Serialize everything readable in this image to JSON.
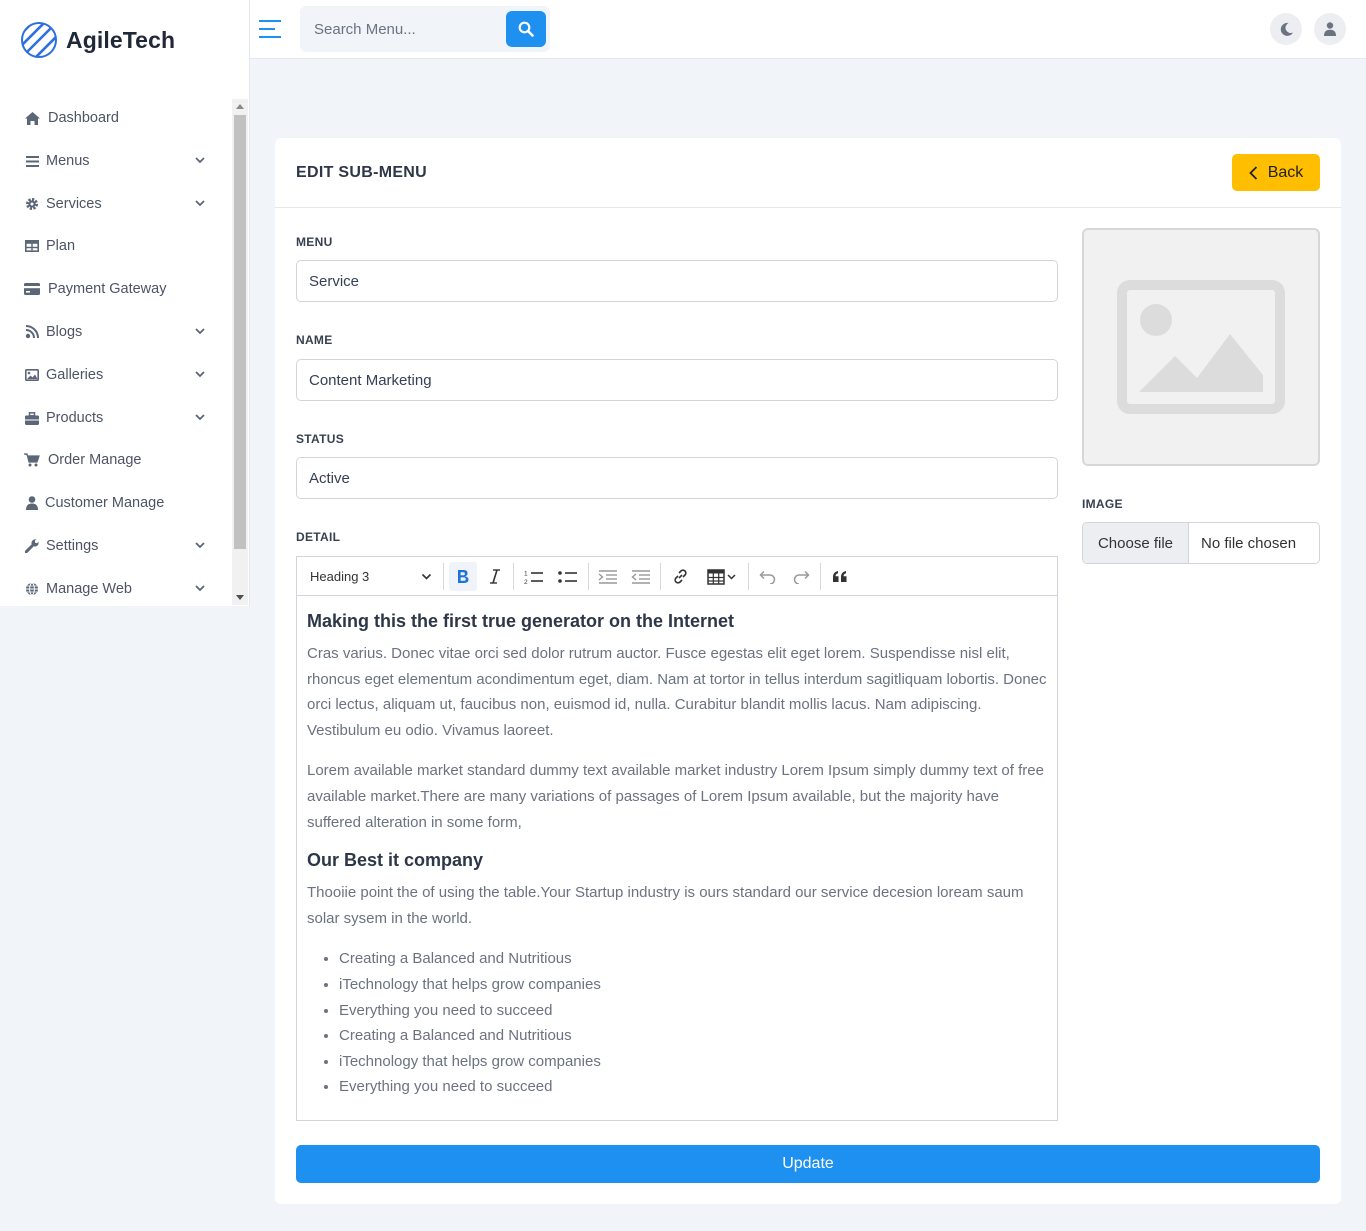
{
  "brand": {
    "name": "AgileTech"
  },
  "topbar": {
    "search_placeholder": "Search Menu...",
    "icons": [
      "hamburger-icon",
      "search-icon",
      "moon-icon",
      "user-icon"
    ]
  },
  "sidebar": {
    "items": [
      {
        "label": "Dashboard",
        "icon": "home-icon",
        "has_children": false
      },
      {
        "label": "Menus",
        "icon": "bars-icon",
        "has_children": true
      },
      {
        "label": "Services",
        "icon": "gear-icon",
        "has_children": true
      },
      {
        "label": "Plan",
        "icon": "table-icon",
        "has_children": false
      },
      {
        "label": "Payment Gateway",
        "icon": "credit-card-icon",
        "has_children": false
      },
      {
        "label": "Blogs",
        "icon": "blog-icon",
        "has_children": true
      },
      {
        "label": "Galleries",
        "icon": "image-icon",
        "has_children": true
      },
      {
        "label": "Products",
        "icon": "briefcase-icon",
        "has_children": true
      },
      {
        "label": "Order Manage",
        "icon": "cart-icon",
        "has_children": false
      },
      {
        "label": "Customer Manage",
        "icon": "user-icon",
        "has_children": false
      },
      {
        "label": "Settings",
        "icon": "wrench-icon",
        "has_children": true
      },
      {
        "label": "Manage Web",
        "icon": "globe-icon",
        "has_children": true
      }
    ]
  },
  "card": {
    "title": "EDIT SUB-MENU",
    "back_label": "Back"
  },
  "form": {
    "menu": {
      "label": "MENU",
      "value": "Service"
    },
    "name": {
      "label": "NAME",
      "value": "Content Marketing"
    },
    "status": {
      "label": "STATUS",
      "value": "Active"
    },
    "detail": {
      "label": "DETAIL"
    },
    "image": {
      "label": "IMAGE",
      "choose_label": "Choose file",
      "status": "No file chosen"
    },
    "update_label": "Update"
  },
  "editor": {
    "heading_select": "Heading 3",
    "toolbar_icons": [
      "bold-icon",
      "italic-icon",
      "numbered-list-icon",
      "bulleted-list-icon",
      "indent-icon",
      "outdent-icon",
      "link-icon",
      "table-icon",
      "undo-icon",
      "redo-icon",
      "blockquote-icon"
    ],
    "content": {
      "h1": "Making this the first true generator on the Internet",
      "p1": "Cras varius. Donec vitae orci sed dolor rutrum auctor. Fusce egestas elit eget lorem. Suspendisse nisl elit, rhoncus eget elementum acondimentum eget, diam. Nam at tortor in tellus interdum sagitliquam lobortis. Donec orci lectus, aliquam ut, faucibus non, euismod id, nulla. Curabitur blandit mollis lacus. Nam adipiscing. Vestibulum eu odio. Vivamus laoreet.",
      "p2": "Lorem available market standard dummy text available market industry Lorem Ipsum simply dummy text of free available market.There are many variations of passages of Lorem Ipsum available, but the majority have suffered alteration in some form,",
      "h2": "Our Best it company",
      "p3": "Thooiie point the of using the table.Your Startup industry is ours standard our service decesion loream saum solar sysem in the world.",
      "list": [
        "Creating a Balanced and Nutritious",
        "iTechnology that helps grow companies",
        "Everything you need to succeed",
        "Creating a Balanced and Nutritious",
        "iTechnology that helps grow companies",
        "Everything you need to succeed"
      ]
    }
  },
  "colors": {
    "primary": "#1e90ef",
    "warning": "#ffbf00"
  }
}
